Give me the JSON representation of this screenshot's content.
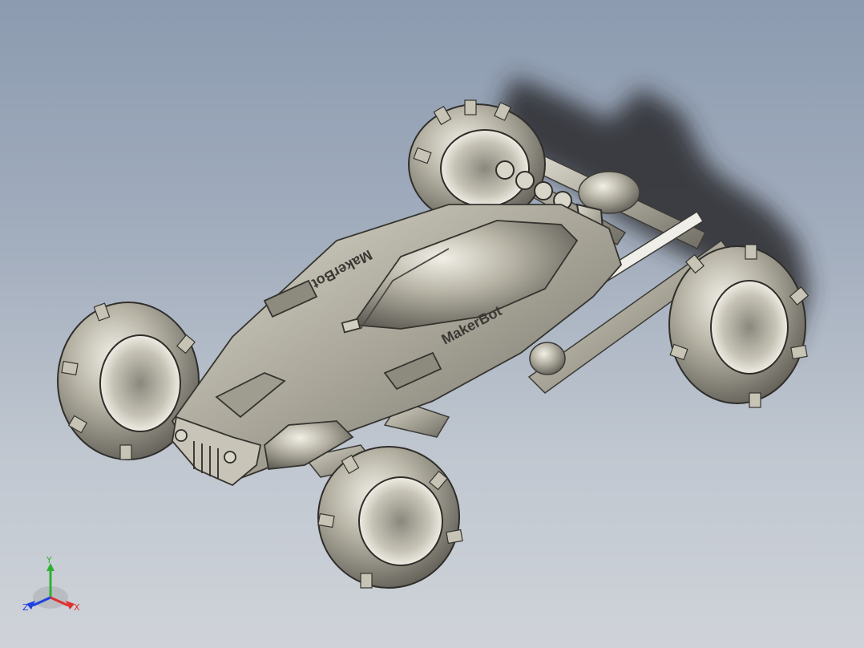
{
  "model": {
    "decal_front": "MakerBot",
    "decal_rear": "MakerBot"
  },
  "triad": {
    "x_label": "X",
    "y_label": "Y",
    "z_label": "Z",
    "x_color": "#e03030",
    "y_color": "#30b030",
    "z_color": "#2040e0"
  },
  "colors": {
    "background_top": "#8c9bb0",
    "background_bottom": "#cfd3d9",
    "body_metal": "#b9b6a8",
    "shadow": "#2a2c2f"
  }
}
